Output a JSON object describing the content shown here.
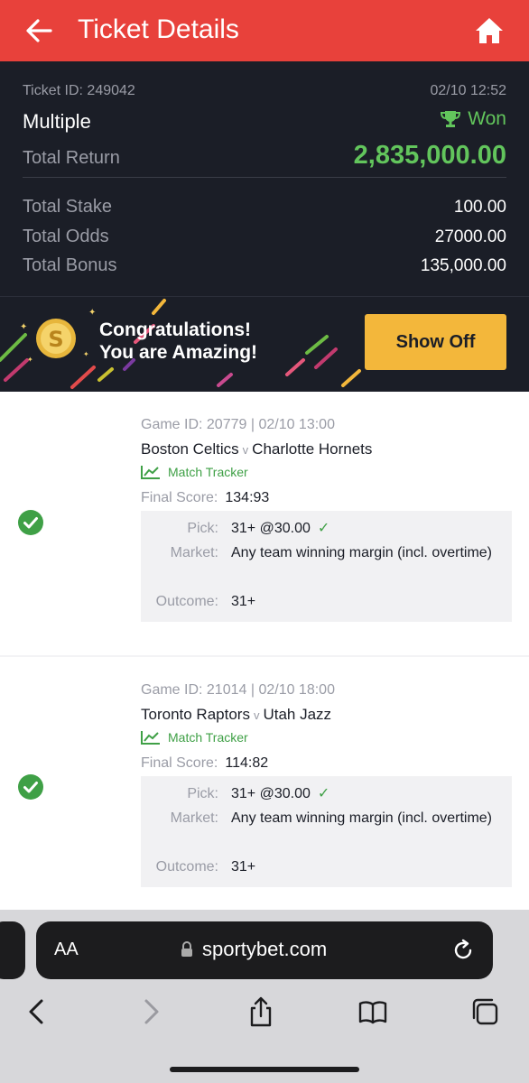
{
  "header": {
    "title": "Ticket Details",
    "back_icon": "arrow-left-icon",
    "home_icon": "home-icon"
  },
  "summary": {
    "ticket_id": "Ticket ID: 249042",
    "datetime": "02/10 12:52",
    "bet_type": "Multiple",
    "status": "Won",
    "total_return_label": "Total Return",
    "total_return": "2,835,000.00",
    "total_stake_label": "Total Stake",
    "total_stake": "100.00",
    "total_odds_label": "Total Odds",
    "total_odds": "27000.00",
    "total_bonus_label": "Total Bonus",
    "total_bonus": "135,000.00"
  },
  "banner": {
    "line1": "Congratulations!",
    "line2": "You are Amazing!",
    "button": "Show Off",
    "coin_glyph": "S"
  },
  "games": [
    {
      "game_id": "Game ID: 20779 | 02/10 13:00",
      "home": "Boston Celtics",
      "vs": "v",
      "away": "Charlotte Hornets",
      "tracker": "Match Tracker",
      "final_score_label": "Final Score:",
      "final_score": "134:93",
      "pick_label": "Pick:",
      "pick": "31+ @30.00",
      "market_label": "Market:",
      "market": "Any team winning margin (incl. overtime)",
      "outcome_label": "Outcome:",
      "outcome": "31+"
    },
    {
      "game_id": "Game ID: 21014 | 02/10 18:00",
      "home": "Toronto Raptors",
      "vs": "v",
      "away": "Utah Jazz",
      "tracker": "Match Tracker",
      "final_score_label": "Final Score:",
      "final_score": "114:82",
      "pick_label": "Pick:",
      "pick": "31+ @30.00",
      "market_label": "Market:",
      "market": "Any team winning margin (incl. overtime)",
      "outcome_label": "Outcome:",
      "outcome": "31+"
    }
  ],
  "browser": {
    "aa_label": "AA",
    "url": "sportybet.com",
    "icons": [
      "lock-icon",
      "reload-icon",
      "back-icon",
      "forward-icon",
      "share-icon",
      "bookmarks-icon",
      "tabs-icon"
    ]
  },
  "colors": {
    "header_red": "#e8413b",
    "dark": "#1b1e27",
    "win_green": "#62c55c",
    "accent_yellow": "#f3b73b"
  }
}
